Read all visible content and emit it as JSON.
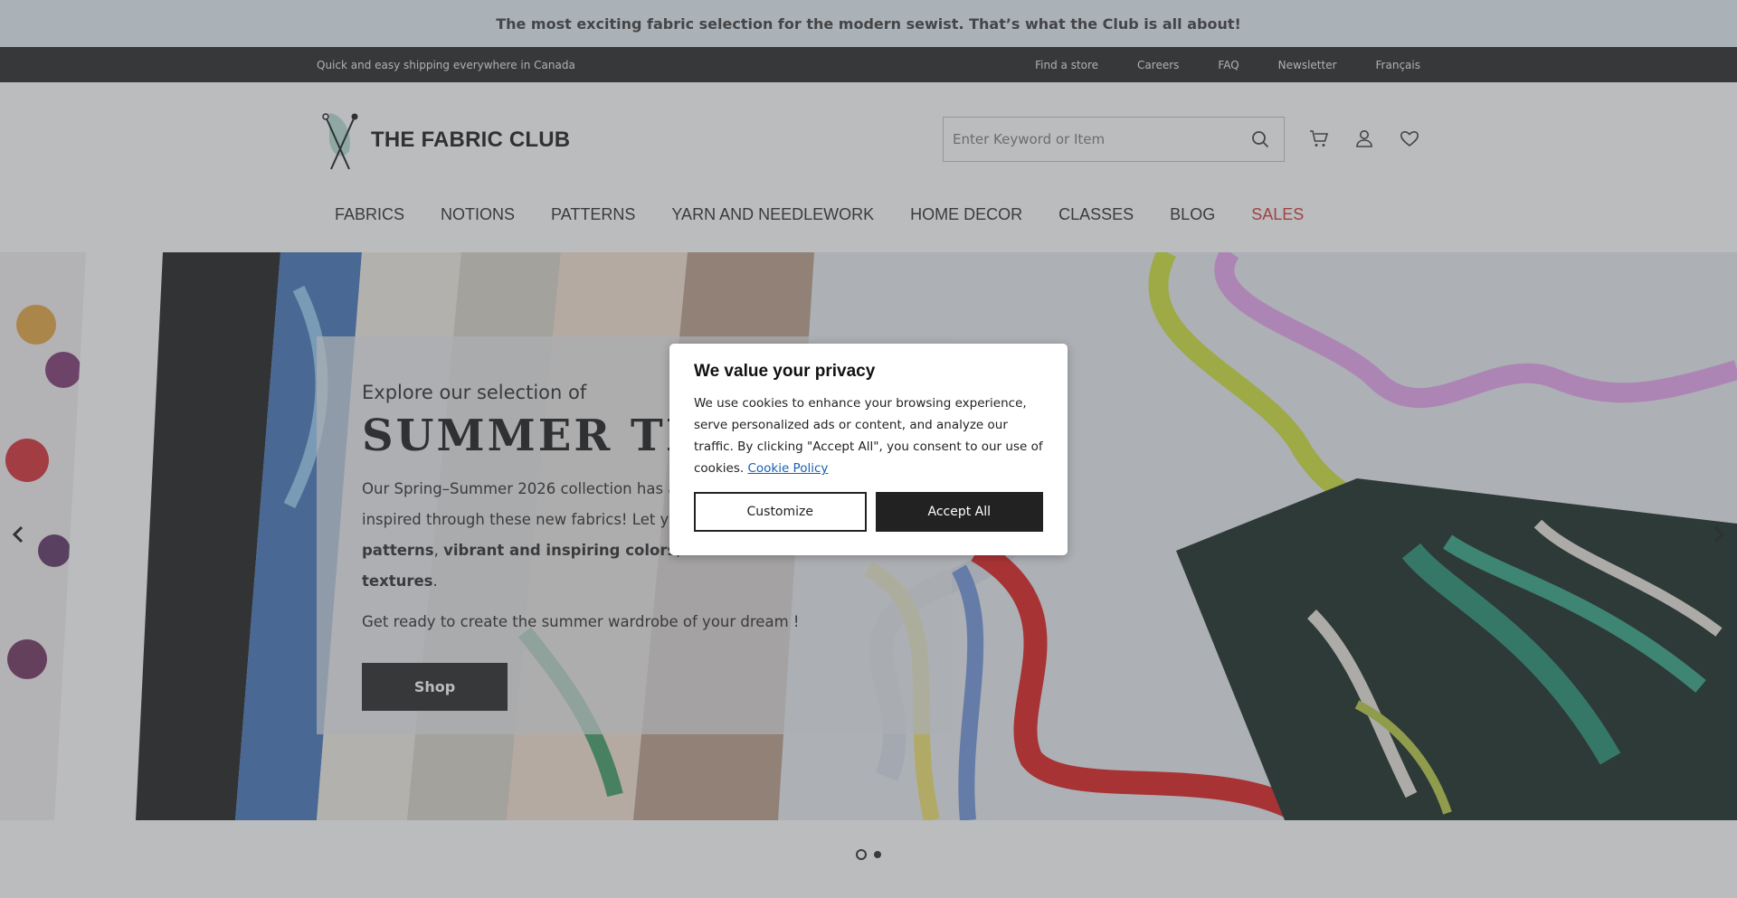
{
  "promo": {
    "text": "The most exciting fabric selection for the modern sewist. That’s what the Club is all about!"
  },
  "utility": {
    "shipping": "Quick and easy shipping everywhere in Canada",
    "links": [
      "Find a store",
      "Careers",
      "FAQ",
      "Newsletter",
      "Français"
    ]
  },
  "header": {
    "brand": "THE FABRIC CLUB",
    "search": {
      "placeholder": "Enter Keyword or Item",
      "icon": "search-icon"
    },
    "icons": [
      "cart-icon",
      "user-icon",
      "heart-icon"
    ]
  },
  "nav": {
    "items": [
      "FABRICS",
      "NOTIONS",
      "PATTERNS",
      "YARN AND NEEDLEWORK",
      "HOME DECOR",
      "CLASSES",
      "BLOG",
      "SALES"
    ],
    "sales_color": "#d62f2f"
  },
  "hero": {
    "kicker": "Explore our selection of",
    "title": "SUMMER TRENDS",
    "body_part1": "Our Spring–Summer 2026 collection has arrived! Let yourself be inspired",
    "body_part2": "through these new fabrics! Let yourself be inspired by our",
    "bold1": "patterns",
    "sep1": ", ",
    "bold2": "vibrant and inspiring colors",
    "sep2": ", and ",
    "bold3": "beautiful textures",
    "end": ".",
    "sub": "Get ready to create the summer wardrobe of your dream !",
    "cta": "Shop",
    "slides": 2,
    "active_slide": 1
  },
  "cookie_modal": {
    "title": "We value your privacy",
    "text": "We use cookies to enhance your browsing experience, serve personalized ads or content, and analyze our traffic. By clicking \"Accept All\", you consent to our use of cookies.",
    "link": "Cookie Policy",
    "customize": "Customize",
    "accept": "Accept All"
  }
}
